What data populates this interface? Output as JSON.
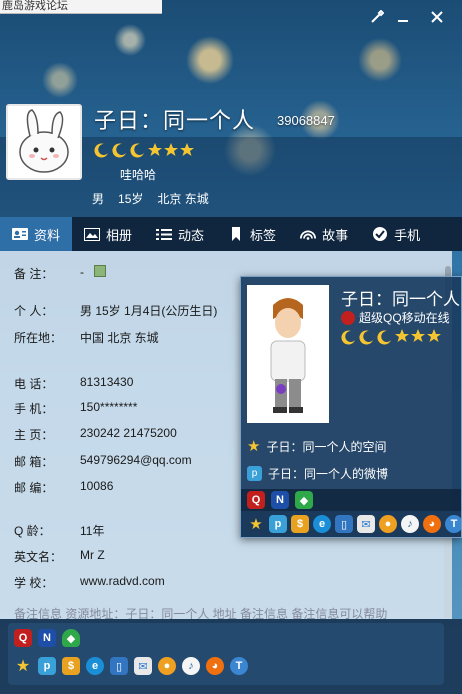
{
  "top_tab": {
    "label": "鹿岛游戏论坛"
  },
  "window": {
    "controls": [
      "skin-icon",
      "minimize-icon",
      "close-icon"
    ]
  },
  "profile": {
    "nickname": "子日：同一个人",
    "qq_number": "39068847",
    "signature": "哇哈哈",
    "gender": "男",
    "age": "15岁",
    "location": "北京 东城"
  },
  "tabs": [
    {
      "label": "资料",
      "icon": "profile-card-icon"
    },
    {
      "label": "相册",
      "icon": "photo-icon"
    },
    {
      "label": "动态",
      "icon": "list-icon"
    },
    {
      "label": "标签",
      "icon": "bookmark-icon"
    },
    {
      "label": "故事",
      "icon": "wifi-icon"
    },
    {
      "label": "手机",
      "icon": "check-badge-icon"
    }
  ],
  "details": {
    "remark_label": "备 注：",
    "remark_value": "-",
    "personal_label": "个 人：",
    "personal_value": "男   15岁   1月4日(公历生日)",
    "location_label": "所在地：",
    "location_value": "中国 北京 东城",
    "phone_label": "电 话：",
    "phone_value": "81313430",
    "mobile_label": "手 机：",
    "mobile_value": "150********",
    "homepage_label": "主 页：",
    "homepage_value": "230242  21475200",
    "email_label": "邮 箱：",
    "email_value": "549796294@qq.com",
    "postcode_label": "邮 编：",
    "postcode_value": "10086",
    "qage_label": "Q 龄：",
    "qage_value": "11年",
    "english_label": "英文名：",
    "english_value": "Mr   Z",
    "school_label": "学 校：",
    "school_value": "www.radvd.com",
    "note_text": "备注信息 资源地址：子日：同一个人 地址 备注信息 备注信息可以帮助"
  },
  "popup": {
    "name": "子日：同一个人",
    "vip_text": "超级QQ移动在线",
    "links": [
      {
        "label": "子日：同一个人的空间",
        "icon": "star-icon"
      },
      {
        "label": "子日：同一个人的微博",
        "icon": "weibo-icon"
      }
    ]
  },
  "colors": {
    "accent": "#2f6fa8",
    "tabbar": "#0f2238",
    "gold": "#f5c531"
  }
}
